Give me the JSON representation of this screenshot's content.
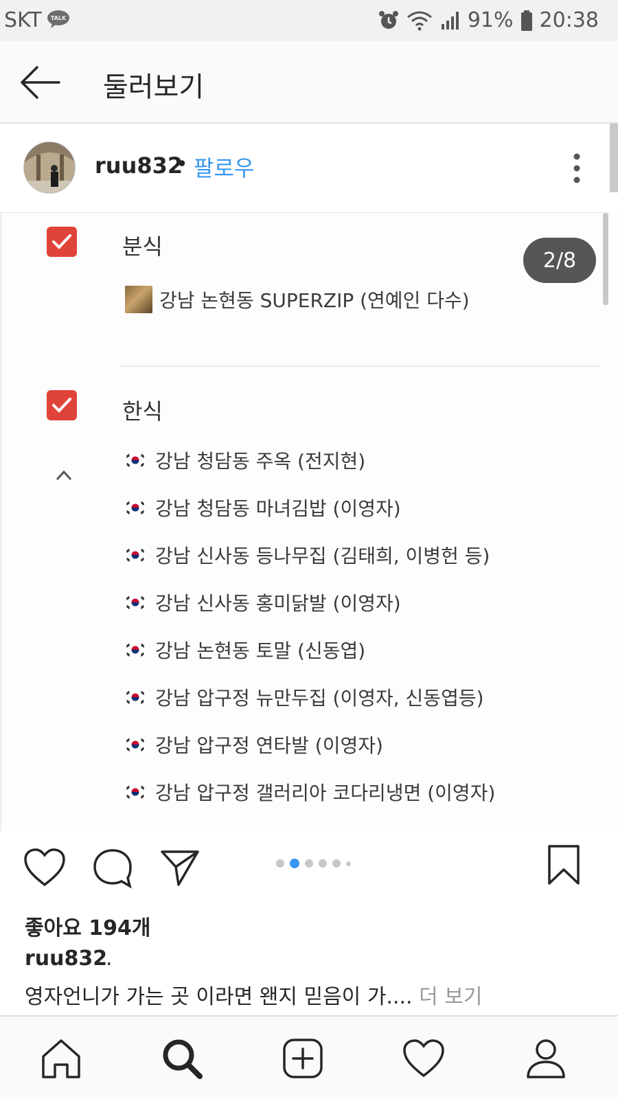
{
  "status_bar": {
    "carrier": "SKT",
    "talk_badge": "TALK",
    "battery": "91%",
    "time": "20:38",
    "icons": [
      "alarm-icon",
      "wifi-icon",
      "signal-icon",
      "battery-icon"
    ]
  },
  "header": {
    "title": "둘러보기",
    "back_icon": "arrow-left-icon"
  },
  "post": {
    "username": "ruu832",
    "separator": "•",
    "follow_label": "팔로우",
    "more_icon": "vertical-dots-icon",
    "counter": "2/8"
  },
  "content": {
    "sections": [
      {
        "title": "분식",
        "items": [
          "강남 논현동 SUPERZIP (연예인 다수)"
        ]
      },
      {
        "title": "한식",
        "items": [
          "강남 청담동 주옥 (전지현)",
          "강남 청담동 마녀김밥 (이영자)",
          "강남 신사동 등나무집 (김태희, 이병헌 등)",
          "강남 신사동 홍미닭발 (이영자)",
          "강남 논현동 토말 (신동엽)",
          "강남 압구정 뉴만두집 (이영자, 신동엽등)",
          "강남 압구정 연타발 (이영자)",
          "강남 압구정 갤러리아 코다리냉면 (이영자)"
        ]
      }
    ]
  },
  "engagement": {
    "likes": "좋아요 194개",
    "caption_user": "ruu832",
    "caption_user_suffix": ".",
    "caption_text": "영자언니가 가는 곳 이라면 왠지 믿음이 가.... ",
    "more_label": "더 보기",
    "carousel_index": 2,
    "carousel_count": 6
  },
  "accent_color": "#3897f0",
  "checkbox_color": "#e0433a"
}
